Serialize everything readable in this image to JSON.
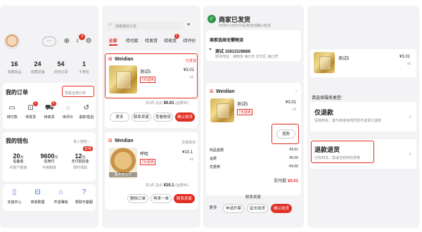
{
  "p1": {
    "stats": [
      {
        "value": "16",
        "label": "收藏商品"
      },
      {
        "value": "24",
        "label": "收藏店铺"
      },
      {
        "value": "54",
        "label": "浏览记录"
      },
      {
        "value": "1",
        "label": "卡券包"
      }
    ],
    "badge": "3",
    "orders_title": "我的订单",
    "view_all": "查看全部订单",
    "order_icons": [
      {
        "label": "待付款",
        "icon": "wallet-icon",
        "glyph": "▭"
      },
      {
        "label": "待发货",
        "icon": "box-icon",
        "glyph": "⊡",
        "badge": "1"
      },
      {
        "label": "待收货",
        "icon": "truck-icon",
        "glyph": "⛟",
        "badge": "1"
      },
      {
        "label": "待评价",
        "icon": "chat-icon",
        "glyph": "◌"
      },
      {
        "label": "退款/售后",
        "icon": "refund-icon",
        "glyph": "↺"
      }
    ],
    "wallet_title": "我的钱包",
    "wallet_link": "进入钱包 ›",
    "wallet_items": [
      {
        "value": "20",
        "unit": "元",
        "label": "后备金",
        "sub": "共剩下额度"
      },
      {
        "value": "9600",
        "unit": "元",
        "label": "信用付",
        "sub": "可用额度"
      },
      {
        "value": "12",
        "unit": "元",
        "label": "支付抵扣金",
        "sub": "限时领取",
        "tag": "去领"
      }
    ],
    "bottom_icons": [
      {
        "label": "充值中心",
        "icon": "phone-icon",
        "glyph": "▯"
      },
      {
        "label": "商家助理",
        "icon": "assistant-icon",
        "glyph": "⊟"
      },
      {
        "label": "开店赚钱",
        "icon": "shop-icon",
        "glyph": "⌂"
      },
      {
        "label": "帮助与客服",
        "icon": "help-icon",
        "glyph": "?"
      }
    ]
  },
  "p2": {
    "search_placeholder": "搜索我的订单",
    "tabs": [
      "全部",
      "待付款",
      "待发货",
      "待收货",
      "待评价"
    ],
    "tab_badge": "1",
    "order1": {
      "shop": "Weidian",
      "status": "已发货",
      "title": "测试5",
      "tag": "7天退换",
      "price": "¥3.01",
      "qty": "x1",
      "total_prefix": "共1件 总价",
      "total": "¥0.01",
      "total_suffix": "(运费¥0)",
      "buttons": [
        "更多",
        "联系卖家",
        "查看物流",
        "确认收货"
      ]
    },
    "order2": {
      "shop": "Weidian",
      "status": "交易成功",
      "title": "呼哈",
      "tag": "7天退换",
      "caption": "我不开心了",
      "price": "¥10.1",
      "qty": "x1",
      "total_prefix": "共1件 总价",
      "total": "¥10.1",
      "total_suffix": "(运费¥0)",
      "buttons": [
        "删除订单",
        "再来一单",
        "联系卖家"
      ]
    }
  },
  "p3": {
    "title": "商家已发货",
    "subtitle": "26天9小时20分后将自动确认收货",
    "logistics": "商家选择无需物流",
    "addr_name": "测试 15811528888",
    "addr_line": "收货地址：湖南省 海口市 龙华区 海口湾",
    "shop": "Weidian",
    "item_title": "测试5",
    "item_price": "¥3.01",
    "item_qty": "x1",
    "tag": "7天退换",
    "refund_btn": "退款",
    "rows": [
      {
        "k": "商品金额",
        "v": "¥3.01"
      },
      {
        "k": "运费",
        "v": "¥0.00"
      },
      {
        "k": "优惠券",
        "v": "-¥3.00"
      }
    ],
    "paid_label": "实付款",
    "paid_value": "¥0.01",
    "contact": "联系卖家",
    "buttons": [
      "更多",
      "申请开票",
      "延长收货",
      "确认收货"
    ]
  },
  "p4": {
    "item_title": "测试5",
    "item_price": "¥3.01",
    "item_qty": "x1",
    "section_label": "请选择服务类型:",
    "opt1_title": "仅退款",
    "opt1_desc": "没收到货，或与卖家协商同意不退货只退款",
    "opt2_title": "退款退货",
    "opt2_desc": "已收到货，需退还收到的货物"
  }
}
